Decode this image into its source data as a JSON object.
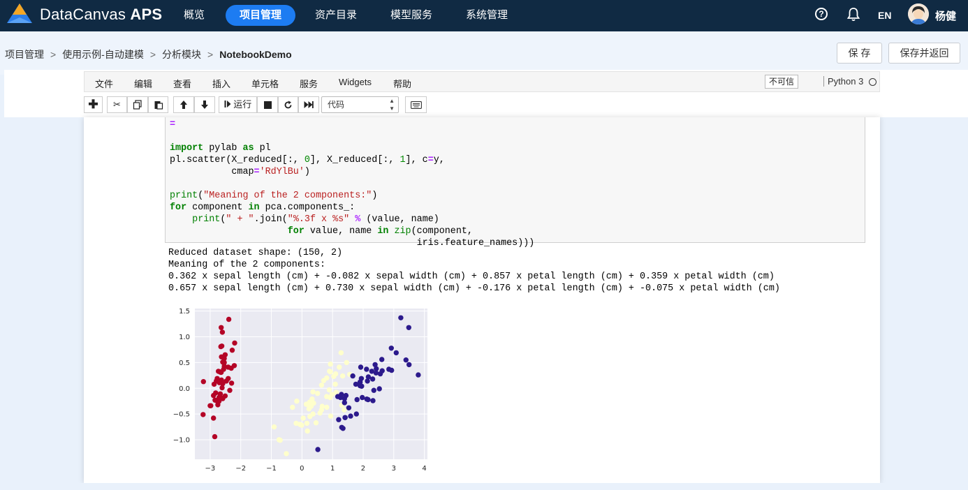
{
  "app": {
    "brand": "DataCanvas",
    "brand_bold": "APS"
  },
  "nav": {
    "items": [
      "概览",
      "项目管理",
      "资产目录",
      "模型服务",
      "系统管理"
    ],
    "active": 1
  },
  "header": {
    "help_glyph": "?",
    "lang": "EN",
    "user": "杨健"
  },
  "breadcrumb": {
    "items": [
      "项目管理",
      "使用示例-自动建模",
      "分析模块",
      "NotebookDemo"
    ],
    "sep": ">"
  },
  "actions": {
    "save": "保 存",
    "save_return": "保存并返回"
  },
  "notebook": {
    "menu": [
      "文件",
      "编辑",
      "查看",
      "插入",
      "单元格",
      "服务",
      "Widgets",
      "帮助"
    ],
    "trusted_label": "不可信",
    "kernel": "Python 3",
    "toolbar": {
      "run_label": "运行",
      "cell_type": "代码"
    },
    "output_lines": [
      "Reduced dataset shape: (150, 2)",
      "Meaning of the 2 components:",
      "0.362 x sepal length (cm) + -0.082 x sepal width (cm) + 0.857 x petal length (cm) + 0.359 x petal width (cm)",
      "0.657 x sepal length (cm) + 0.730 x sepal width (cm) + -0.176 x petal length (cm) + -0.075 x petal width (cm)"
    ]
  },
  "colors": {
    "nav_bg": "#102a43",
    "accent": "#1d7cf2",
    "class0": "#b40426",
    "class1": "#ffffcc",
    "class2": "#2c1a8c",
    "plot_bg": "#eaeaf2"
  },
  "chart_data": {
    "type": "scatter",
    "xlim": [
      -3.5,
      4.1
    ],
    "ylim": [
      -1.38,
      1.55
    ],
    "xticks": [
      "−3",
      "−2",
      "−1",
      "0",
      "1",
      "2",
      "3",
      "4"
    ],
    "xtick_values": [
      -3,
      -2,
      -1,
      0,
      1,
      2,
      3,
      4
    ],
    "yticks": [
      "1.5",
      "1.0",
      "0.5",
      "0.0",
      "−0.5",
      "−1.0"
    ],
    "ytick_values": [
      1.5,
      1.0,
      0.5,
      0.0,
      -0.5,
      -1.0
    ],
    "grid": true,
    "series": [
      {
        "color": "#b40426",
        "points": [
          [
            -2.68,
            0.32
          ],
          [
            -2.71,
            -0.18
          ],
          [
            -2.89,
            -0.14
          ],
          [
            -2.75,
            -0.32
          ],
          [
            -2.73,
            0.33
          ],
          [
            -2.28,
            0.74
          ],
          [
            -2.82,
            -0.09
          ],
          [
            -2.63,
            0.16
          ],
          [
            -2.89,
            -0.58
          ],
          [
            -2.67,
            -0.11
          ],
          [
            -2.51,
            0.65
          ],
          [
            -2.61,
            0.01
          ],
          [
            -2.79,
            -0.24
          ],
          [
            -3.23,
            -0.51
          ],
          [
            -2.64,
            1.18
          ],
          [
            -2.39,
            1.34
          ],
          [
            -2.62,
            0.82
          ],
          [
            -2.65,
            0.31
          ],
          [
            -2.2,
            0.88
          ],
          [
            -2.59,
            0.51
          ],
          [
            -2.31,
            0.39
          ],
          [
            -2.54,
            0.43
          ],
          [
            -3.22,
            0.13
          ],
          [
            -2.3,
            0.1
          ],
          [
            -2.36,
            -0.04
          ],
          [
            -2.51,
            -0.15
          ],
          [
            -2.47,
            0.14
          ],
          [
            -2.56,
            0.37
          ],
          [
            -2.64,
            0.31
          ],
          [
            -2.63,
            -0.19
          ],
          [
            -2.59,
            -0.2
          ],
          [
            -2.41,
            0.41
          ],
          [
            -2.65,
            0.81
          ],
          [
            -2.6,
            1.09
          ],
          [
            -2.67,
            -0.11
          ],
          [
            -2.87,
            0.08
          ],
          [
            -2.63,
            0.61
          ],
          [
            -2.8,
            0.14
          ],
          [
            -2.98,
            -0.34
          ],
          [
            -2.59,
            0.09
          ],
          [
            -2.77,
            0.19
          ],
          [
            -2.85,
            -0.94
          ],
          [
            -3.0,
            -0.34
          ],
          [
            -2.41,
            0.19
          ],
          [
            -2.21,
            0.44
          ],
          [
            -2.71,
            -0.25
          ],
          [
            -2.54,
            0.5
          ],
          [
            -2.84,
            -0.23
          ],
          [
            -2.54,
            0.58
          ],
          [
            -2.7,
            0.11
          ]
        ]
      },
      {
        "color": "#ffffcc",
        "points": [
          [
            1.28,
            0.69
          ],
          [
            0.93,
            0.32
          ],
          [
            1.46,
            0.5
          ],
          [
            0.18,
            -0.83
          ],
          [
            1.09,
            0.08
          ],
          [
            0.64,
            -0.42
          ],
          [
            1.1,
            0.28
          ],
          [
            -0.75,
            -1.0
          ],
          [
            1.04,
            0.23
          ],
          [
            -0.01,
            -0.72
          ],
          [
            -0.51,
            -1.27
          ],
          [
            0.51,
            -0.1
          ],
          [
            0.26,
            -0.55
          ],
          [
            0.98,
            -0.12
          ],
          [
            -0.17,
            -0.25
          ],
          [
            0.93,
            0.47
          ],
          [
            0.66,
            -0.35
          ],
          [
            0.23,
            -0.33
          ],
          [
            0.94,
            -0.54
          ],
          [
            0.04,
            -0.58
          ],
          [
            1.12,
            -0.08
          ],
          [
            0.36,
            -0.07
          ],
          [
            1.3,
            -0.33
          ],
          [
            0.92,
            -0.18
          ],
          [
            0.71,
            0.15
          ],
          [
            0.9,
            0.33
          ],
          [
            1.33,
            0.24
          ],
          [
            1.56,
            0.27
          ],
          [
            0.81,
            -0.16
          ],
          [
            -0.31,
            -0.37
          ],
          [
            -0.07,
            -0.7
          ],
          [
            -0.19,
            -0.68
          ],
          [
            0.14,
            -0.31
          ],
          [
            1.38,
            -0.42
          ],
          [
            0.59,
            -0.48
          ],
          [
            0.81,
            0.2
          ],
          [
            1.22,
            0.41
          ],
          [
            0.81,
            -0.37
          ],
          [
            0.25,
            -0.27
          ],
          [
            0.16,
            -0.68
          ],
          [
            0.46,
            -0.67
          ],
          [
            0.89,
            -0.03
          ],
          [
            0.23,
            -0.4
          ],
          [
            -0.71,
            -1.01
          ],
          [
            0.36,
            -0.5
          ],
          [
            0.33,
            -0.21
          ],
          [
            0.38,
            -0.29
          ],
          [
            0.64,
            0.06
          ],
          [
            -0.91,
            -0.75
          ],
          [
            0.3,
            -0.35
          ]
        ]
      },
      {
        "color": "#2c1a8c",
        "points": [
          [
            2.53,
            -0.01
          ],
          [
            1.41,
            -0.57
          ],
          [
            2.62,
            0.34
          ],
          [
            1.97,
            -0.18
          ],
          [
            2.35,
            -0.04
          ],
          [
            3.4,
            0.55
          ],
          [
            0.52,
            -1.19
          ],
          [
            2.93,
            0.35
          ],
          [
            2.32,
            -0.24
          ],
          [
            2.92,
            0.78
          ],
          [
            1.66,
            0.24
          ],
          [
            1.8,
            -0.22
          ],
          [
            2.17,
            0.22
          ],
          [
            1.34,
            -0.78
          ],
          [
            1.59,
            -0.54
          ],
          [
            1.9,
            0.12
          ],
          [
            1.95,
            0.04
          ],
          [
            3.49,
            1.18
          ],
          [
            3.8,
            0.26
          ],
          [
            1.3,
            -0.76
          ],
          [
            2.43,
            0.38
          ],
          [
            1.2,
            -0.61
          ],
          [
            3.5,
            0.46
          ],
          [
            1.39,
            -0.2
          ],
          [
            2.28,
            0.33
          ],
          [
            2.61,
            0.56
          ],
          [
            1.26,
            -0.18
          ],
          [
            1.29,
            -0.12
          ],
          [
            2.12,
            -0.21
          ],
          [
            2.39,
            0.46
          ],
          [
            2.84,
            0.37
          ],
          [
            3.23,
            1.37
          ],
          [
            2.16,
            -0.22
          ],
          [
            1.44,
            -0.14
          ],
          [
            1.78,
            -0.5
          ],
          [
            3.08,
            0.69
          ],
          [
            2.14,
            0.14
          ],
          [
            1.9,
            0.05
          ],
          [
            1.17,
            -0.16
          ],
          [
            2.11,
            0.37
          ],
          [
            2.31,
            0.18
          ],
          [
            1.92,
            0.41
          ],
          [
            1.41,
            -0.57
          ],
          [
            2.56,
            0.28
          ],
          [
            2.42,
            0.3
          ],
          [
            1.94,
            0.19
          ],
          [
            1.53,
            -0.38
          ],
          [
            1.76,
            0.08
          ],
          [
            1.9,
            0.12
          ],
          [
            1.39,
            -0.28
          ]
        ]
      }
    ]
  }
}
